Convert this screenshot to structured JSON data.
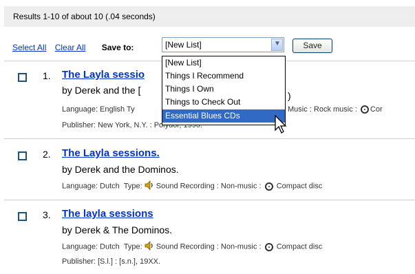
{
  "header": {
    "results_text": "Results 1-10 of about 10 (.04 seconds)"
  },
  "toolbar": {
    "select_all": "Select All",
    "clear_all": "Clear All",
    "save_to_label": "Save to:",
    "list_value": "[New List]",
    "save_button": "Save"
  },
  "dropdown": {
    "options": [
      "[New List]",
      "Things I Recommend",
      "Things I Own",
      "Things to Check Out",
      "Essential Blues CDs"
    ],
    "highlighted_index": 4
  },
  "results": [
    {
      "number": "1.",
      "title": "The Layla sessio",
      "author": "by Derek and the [",
      "author_tail": ")",
      "meta_lang": "Language: English Ty",
      "meta_type_tail": "Music : Rock music :",
      "meta_format_tail": "Cor",
      "publisher": "Publisher: New York, N.Y. : Polydor, 1990."
    },
    {
      "number": "2.",
      "title": "The Layla sessions.",
      "author": "by Derek and the Dominos.",
      "meta_lang": "Language: Dutch",
      "meta_type_label": "Type:",
      "meta_type": "Sound Recording : Non-music :",
      "meta_format": "Compact disc"
    },
    {
      "number": "3.",
      "title": "The layla sessions",
      "author": "by Derek & The Dominos.",
      "meta_lang": "Language: Dutch",
      "meta_type_label": "Type:",
      "meta_type": "Sound Recording : Non-music :",
      "meta_format": "Compact disc",
      "publisher": "Publisher: [S.l.] : [s.n.], 19XX."
    }
  ],
  "colors": {
    "link": "#0033cc",
    "highlight": "#316ac5",
    "bar": "#eeeeee"
  },
  "icons": [
    "speaker-icon",
    "compact-disc-icon",
    "dropdown-arrow-icon",
    "mouse-cursor-icon"
  ]
}
